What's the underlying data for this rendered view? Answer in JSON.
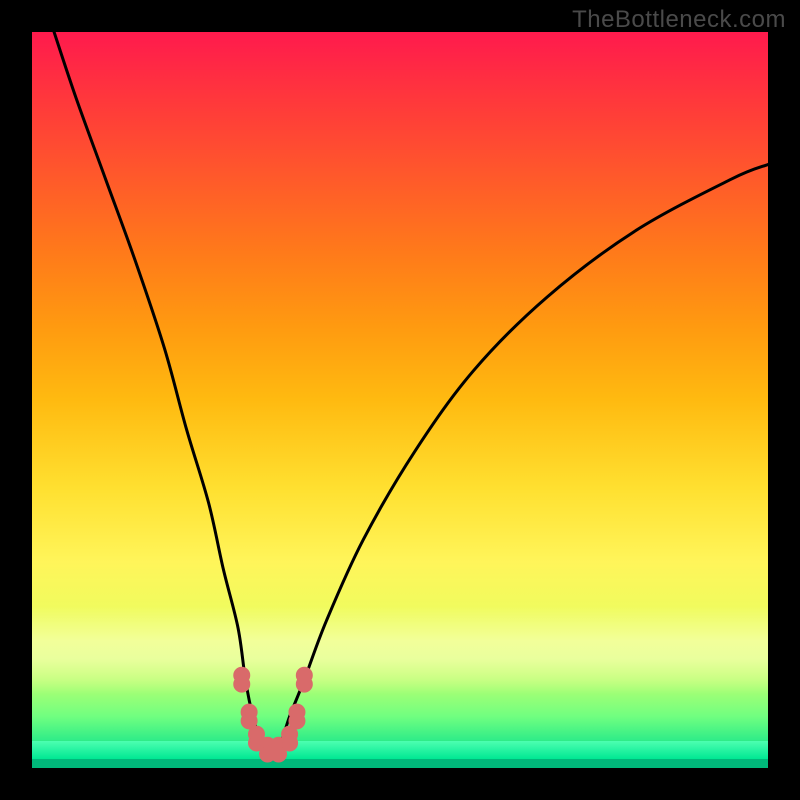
{
  "watermark": "TheBottleneck.com",
  "chart_data": {
    "type": "line",
    "title": "",
    "xlabel": "",
    "ylabel": "",
    "xlim": [
      0,
      100
    ],
    "ylim": [
      0,
      100
    ],
    "grid": false,
    "legend": false,
    "series": [
      {
        "name": "bottleneck-curve",
        "x": [
          3,
          6,
          10,
          14,
          18,
          21,
          24,
          26,
          28,
          29,
          30,
          31,
          32,
          33,
          34,
          35,
          37,
          40,
          45,
          52,
          60,
          70,
          82,
          95,
          100
        ],
        "y": [
          100,
          91,
          80,
          69,
          57,
          46,
          36,
          27,
          19,
          12,
          7,
          4,
          2.5,
          2.5,
          4,
          7,
          12,
          20,
          31,
          43,
          54,
          64,
          73,
          80,
          82
        ]
      }
    ],
    "annotations": {
      "valley_center_x": 32.5,
      "valley_min_y": 2.5,
      "bumps": [
        {
          "x": 28.5,
          "y": 12
        },
        {
          "x": 29.5,
          "y": 7
        },
        {
          "x": 30.5,
          "y": 4
        },
        {
          "x": 32.0,
          "y": 2.5
        },
        {
          "x": 33.5,
          "y": 2.5
        },
        {
          "x": 35.0,
          "y": 4
        },
        {
          "x": 36.0,
          "y": 7
        },
        {
          "x": 37.0,
          "y": 12
        }
      ]
    },
    "background_gradient_stops": [
      {
        "pos": 0.0,
        "color": "#ff1a4d"
      },
      {
        "pos": 0.5,
        "color": "#ffba10"
      },
      {
        "pos": 0.72,
        "color": "#fff55a"
      },
      {
        "pos": 1.0,
        "color": "#00d890"
      }
    ]
  }
}
